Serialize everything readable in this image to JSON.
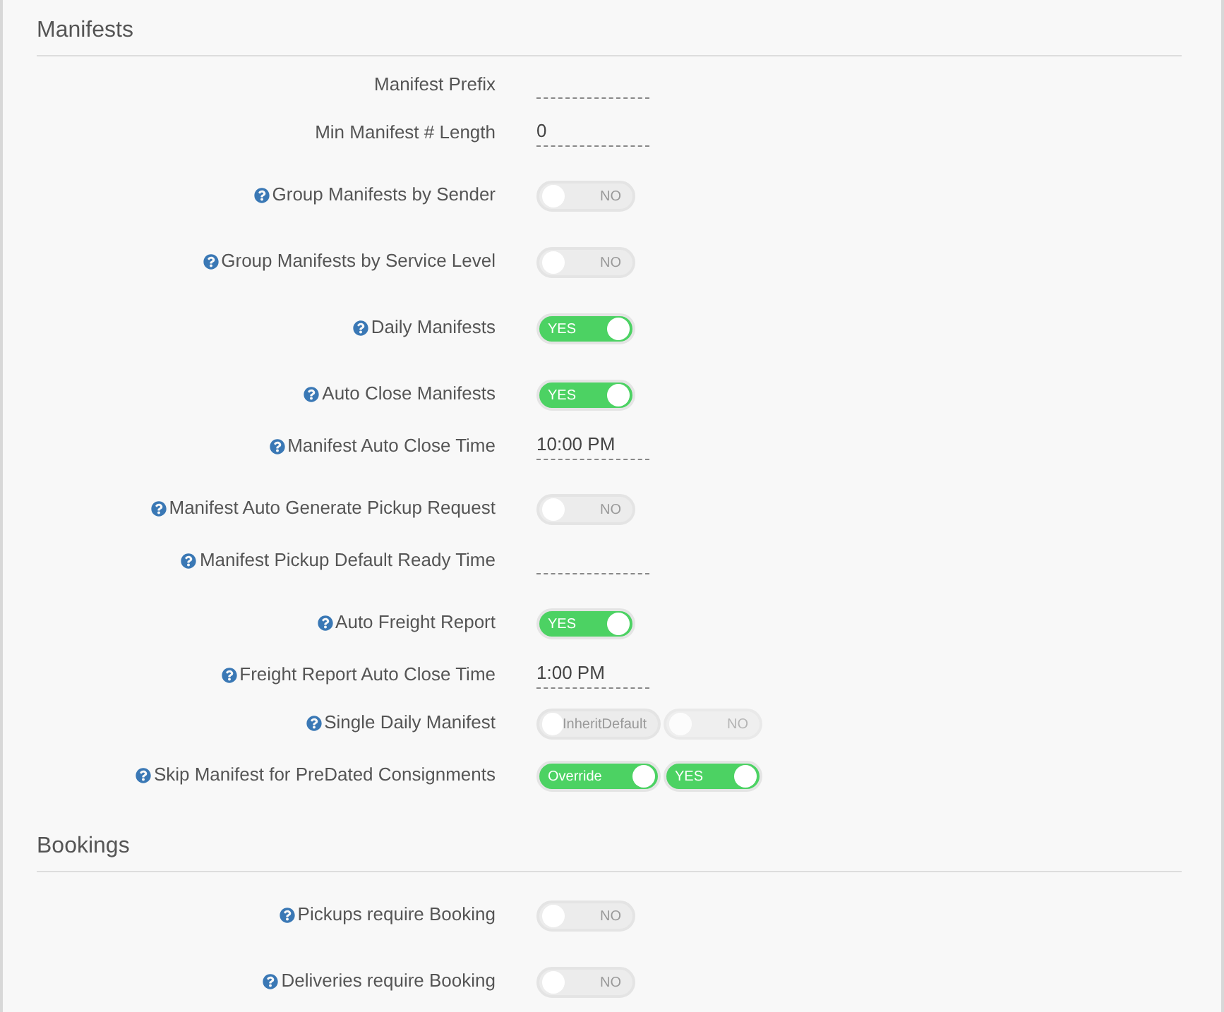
{
  "sections": [
    {
      "title": "Manifests",
      "rows": [
        {
          "kind": "field",
          "label": "Manifest Prefix",
          "help": false
        },
        {
          "kind": "field",
          "label": "Min Manifest # Length",
          "help": false,
          "value": "0"
        },
        {
          "kind": "toggle",
          "label": "Group Manifests by Sender",
          "help": true,
          "toggles": [
            {
              "text": "NO",
              "on": false,
              "disabled": false
            }
          ]
        },
        {
          "kind": "toggle",
          "label": "Group Manifests by Service Level",
          "help": true,
          "toggles": [
            {
              "text": "NO",
              "on": false,
              "disabled": false
            }
          ]
        },
        {
          "kind": "toggle",
          "label": "Daily Manifests",
          "help": true,
          "toggles": [
            {
              "text": "YES",
              "on": true,
              "disabled": false
            }
          ]
        },
        {
          "kind": "toggle",
          "label": "Auto Close Manifests",
          "help": true,
          "toggles": [
            {
              "text": "YES",
              "on": true,
              "disabled": false
            }
          ]
        },
        {
          "kind": "field",
          "label": "Manifest Auto Close Time",
          "help": true,
          "value": "10:00 PM"
        },
        {
          "kind": "toggle",
          "label": "Manifest Auto Generate Pickup Request",
          "help": true,
          "toggles": [
            {
              "text": "NO",
              "on": false,
              "disabled": false
            }
          ]
        },
        {
          "kind": "field",
          "label": "Manifest Pickup Default Ready Time",
          "help": true
        },
        {
          "kind": "toggle",
          "label": "Auto Freight Report",
          "help": true,
          "toggles": [
            {
              "text": "YES",
              "on": true,
              "disabled": false
            }
          ]
        },
        {
          "kind": "field",
          "label": "Freight Report Auto Close Time",
          "help": true,
          "value": "1:00 PM"
        },
        {
          "kind": "pair",
          "label": "Single Daily Manifest",
          "help": true,
          "toggles": [
            {
              "text": "InheritDefault",
              "on": false,
              "disabled": false
            },
            {
              "text": "NO",
              "on": false,
              "disabled": true
            }
          ]
        },
        {
          "kind": "pair",
          "label": "Skip Manifest for PreDated Consignments",
          "help": true,
          "toggles": [
            {
              "text": "Override",
              "on": true,
              "disabled": false
            },
            {
              "text": "YES",
              "on": true,
              "disabled": false
            }
          ]
        }
      ]
    },
    {
      "title": "Bookings",
      "rows": [
        {
          "kind": "toggle",
          "label": "Pickups require Booking",
          "help": true,
          "toggles": [
            {
              "text": "NO",
              "on": false,
              "disabled": false
            }
          ]
        },
        {
          "kind": "toggle",
          "label": "Deliveries require Booking",
          "help": true,
          "toggles": [
            {
              "text": "NO",
              "on": false,
              "disabled": false
            }
          ]
        }
      ]
    }
  ]
}
